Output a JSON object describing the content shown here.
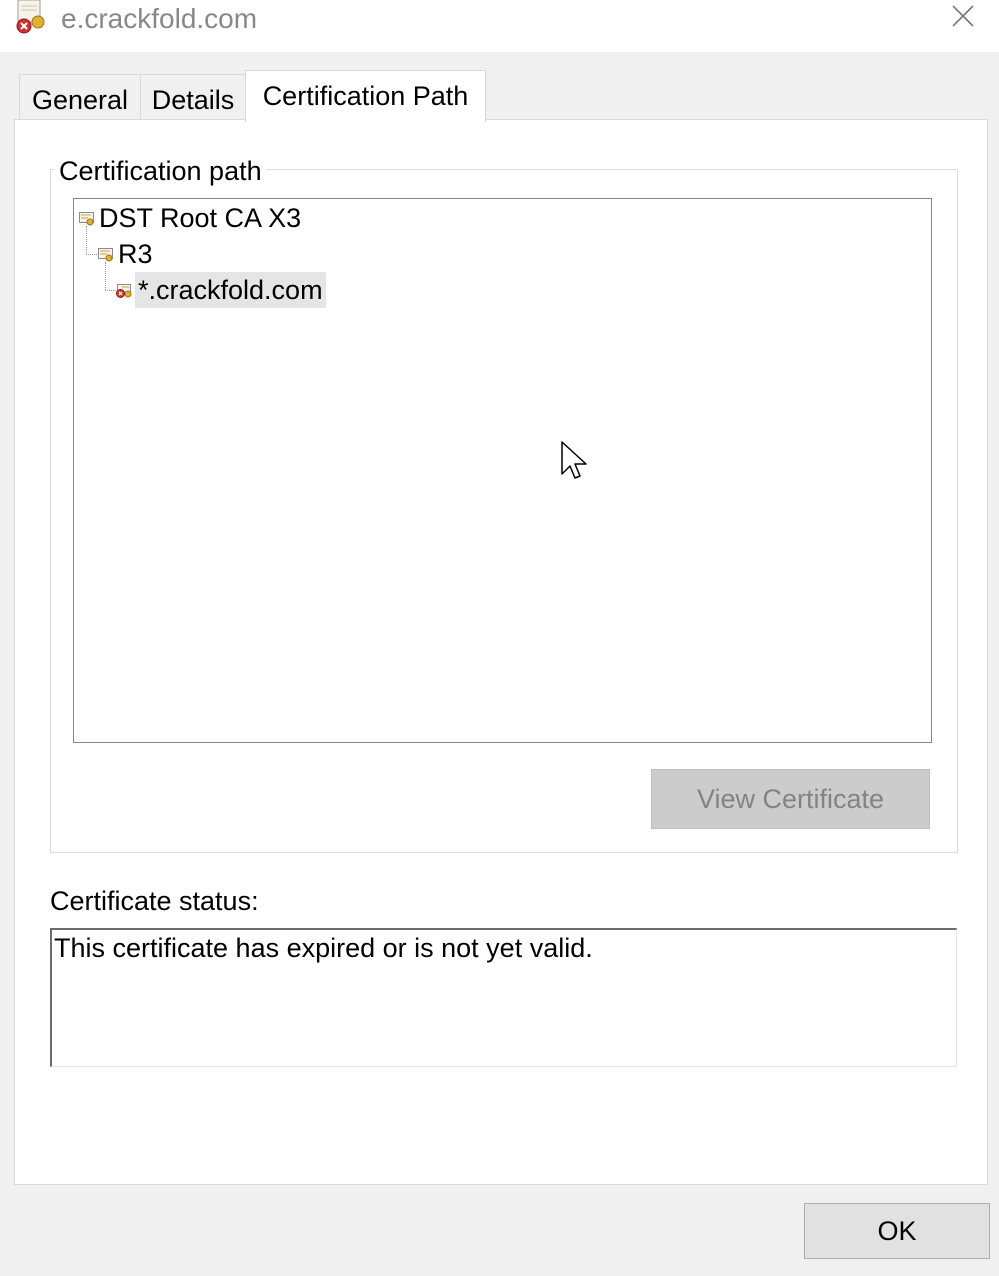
{
  "window": {
    "title": "e.crackfold.com",
    "title_icon": "certificate-error-icon",
    "close_icon": "close-icon"
  },
  "tabs": [
    {
      "label": "General",
      "active": false
    },
    {
      "label": "Details",
      "active": false
    },
    {
      "label": "Certification Path",
      "active": true
    }
  ],
  "certification_path": {
    "group_label": "Certification path",
    "nodes": [
      {
        "label": "DST Root CA X3",
        "icon": "certificate-icon",
        "level": 0,
        "selected": false
      },
      {
        "label": "R3",
        "icon": "certificate-icon",
        "level": 1,
        "selected": false
      },
      {
        "label": "*.crackfold.com",
        "icon": "certificate-error-icon",
        "level": 2,
        "selected": true
      }
    ],
    "view_button_label": "View Certificate"
  },
  "status": {
    "label": "Certificate status:",
    "text": "This certificate has expired or is not yet valid."
  },
  "footer": {
    "ok_label": "OK"
  },
  "colors": {
    "panel_background": "#ffffff",
    "dialog_background": "#f0f0f0",
    "disabled_button": "#cccccc",
    "selection": "#e5e5e5",
    "error_red": "#d32f2f"
  }
}
